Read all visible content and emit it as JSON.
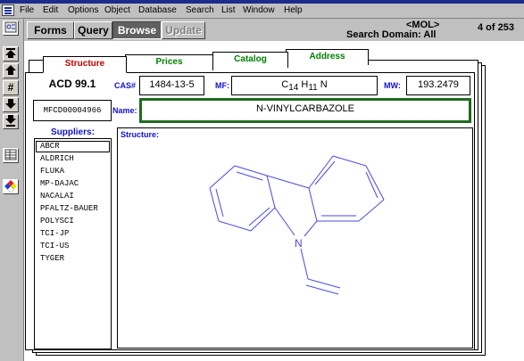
{
  "menubar": {
    "items": [
      "File",
      "Edit",
      "Options",
      "Object",
      "Database",
      "Search",
      "List",
      "Window",
      "Help"
    ]
  },
  "modes": {
    "forms": "Forms",
    "query": "Query",
    "browse": "Browse",
    "update": "Update"
  },
  "header": {
    "mol": "<MOL>",
    "search_domain": "Search Domain:  All",
    "record": "4  of 253"
  },
  "tabs": [
    "Structure",
    "Prices",
    "Catalog",
    "Address"
  ],
  "record": {
    "database": "ACD 99.1",
    "cas_label": "CAS#",
    "cas": "1484-13-5",
    "mf_label": "MF:",
    "mf_c": "C",
    "mf_c_sub": "14",
    "mf_h": "H",
    "mf_h_sub": "11",
    "mf_n": "N",
    "mw_label": "MW:",
    "mw": "193.2479",
    "mfcd": "MFCD00004966",
    "name_label": "Name:",
    "name": "N-VINYLCARBAZOLE",
    "suppliers_label": "Suppliers:",
    "structure_label": "Structure:",
    "suppliers": [
      "ABCR",
      "ALDRICH",
      "FLUKA",
      "MP-DAJAC",
      "NACALAI",
      "PFALTZ-BAUER",
      "POLYSCI",
      "TCI-JP",
      "TCI-US",
      "TYGER"
    ],
    "atom_label": "N"
  },
  "colors": {
    "structure_stroke": "#4a4ae0",
    "name_border": "#1e6b1e",
    "label_blue": "#1010d0"
  }
}
